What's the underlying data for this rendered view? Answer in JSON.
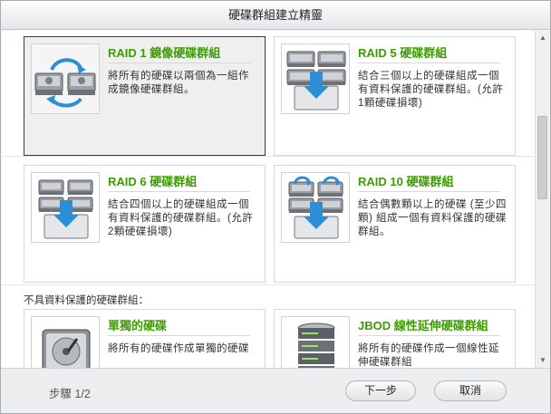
{
  "window": {
    "title": "硬碟群組建立精靈"
  },
  "options": [
    {
      "key": "raid1",
      "title": "RAID 1 鏡像硬碟群組",
      "desc": "將所有的硬碟以兩個為一組作成鏡像硬碟群組。",
      "icon": "raid1-disks-icon",
      "selected": true
    },
    {
      "key": "raid5",
      "title": "RAID 5 硬碟群組",
      "desc": "結合三個以上的硬碟組成一個有資料保護的硬碟群組。(允許1顆硬碟損壞)",
      "icon": "raid5-disks-icon",
      "selected": false
    },
    {
      "key": "raid6",
      "title": "RAID 6 硬碟群組",
      "desc": "結合四個以上的硬碟組成一個有資料保護的硬碟群組。(允許2顆硬碟損壞)",
      "icon": "raid6-disks-icon",
      "selected": false
    },
    {
      "key": "raid10",
      "title": "RAID 10 硬碟群組",
      "desc": "結合偶數顆以上的硬碟 (至少四顆) 組成一個有資料保護的硬碟群組。",
      "icon": "raid10-disks-icon",
      "selected": false
    }
  ],
  "unprotected_section": {
    "label": "不具資料保護的硬碟群組："
  },
  "unprotected_options": [
    {
      "key": "single",
      "title": "單獨的硬碟",
      "desc": "將所有的硬碟作成單獨的硬碟",
      "icon": "single-disk-icon"
    },
    {
      "key": "jbod",
      "title": "JBOD 線性延伸硬碟群組",
      "desc": "將所有的硬碟作成一個線性延伸硬碟群組",
      "icon": "jbod-stack-icon"
    }
  ],
  "footer": {
    "step_label": "步驟 1/2",
    "next_label": "下一步",
    "cancel_label": "取消"
  },
  "colors": {
    "accent_title": "#3d9c00",
    "selected_border": "#3a3a3a"
  }
}
